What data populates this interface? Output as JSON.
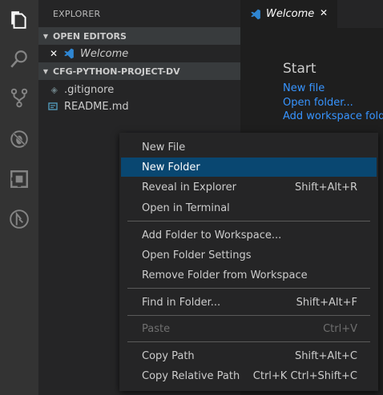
{
  "activity_bar": {
    "icons": [
      "files-icon",
      "search-icon",
      "source-control-icon",
      "debug-icon",
      "extensions-icon",
      "remote-icon"
    ],
    "active_color": "#ffffff",
    "inactive_color": "#858585"
  },
  "sidebar": {
    "title": "EXPLORER",
    "open_editors_header": "OPEN EDITORS",
    "open_editor_item": "Welcome",
    "project_header": "CFG-PYTHON-PROJECT-DV",
    "files": [
      ".gitignore",
      "README.md"
    ]
  },
  "editor": {
    "tab_label": "Welcome",
    "tab_close": "✕",
    "welcome": {
      "heading": "Start",
      "links": [
        "New file",
        "Open folder...",
        "Add workspace folder"
      ]
    }
  },
  "context_menu": {
    "items": [
      {
        "label": "New File",
        "shortcut": ""
      },
      {
        "label": "New Folder",
        "shortcut": ""
      },
      {
        "label": "Reveal in Explorer",
        "shortcut": "Shift+Alt+R"
      },
      {
        "label": "Open in Terminal",
        "shortcut": ""
      },
      {
        "label": "Add Folder to Workspace...",
        "shortcut": ""
      },
      {
        "label": "Open Folder Settings",
        "shortcut": ""
      },
      {
        "label": "Remove Folder from Workspace",
        "shortcut": ""
      },
      {
        "label": "Find in Folder...",
        "shortcut": "Shift+Alt+F"
      },
      {
        "label": "Paste",
        "shortcut": "Ctrl+V"
      },
      {
        "label": "Copy Path",
        "shortcut": "Shift+Alt+C"
      },
      {
        "label": "Copy Relative Path",
        "shortcut": "Ctrl+K Ctrl+Shift+C"
      }
    ],
    "highlighted": "New Folder",
    "disabled": [
      "Paste"
    ]
  },
  "colors": {
    "link": "#3794ff",
    "highlight": "#094771",
    "vscode_blue": "#2f86d2"
  }
}
